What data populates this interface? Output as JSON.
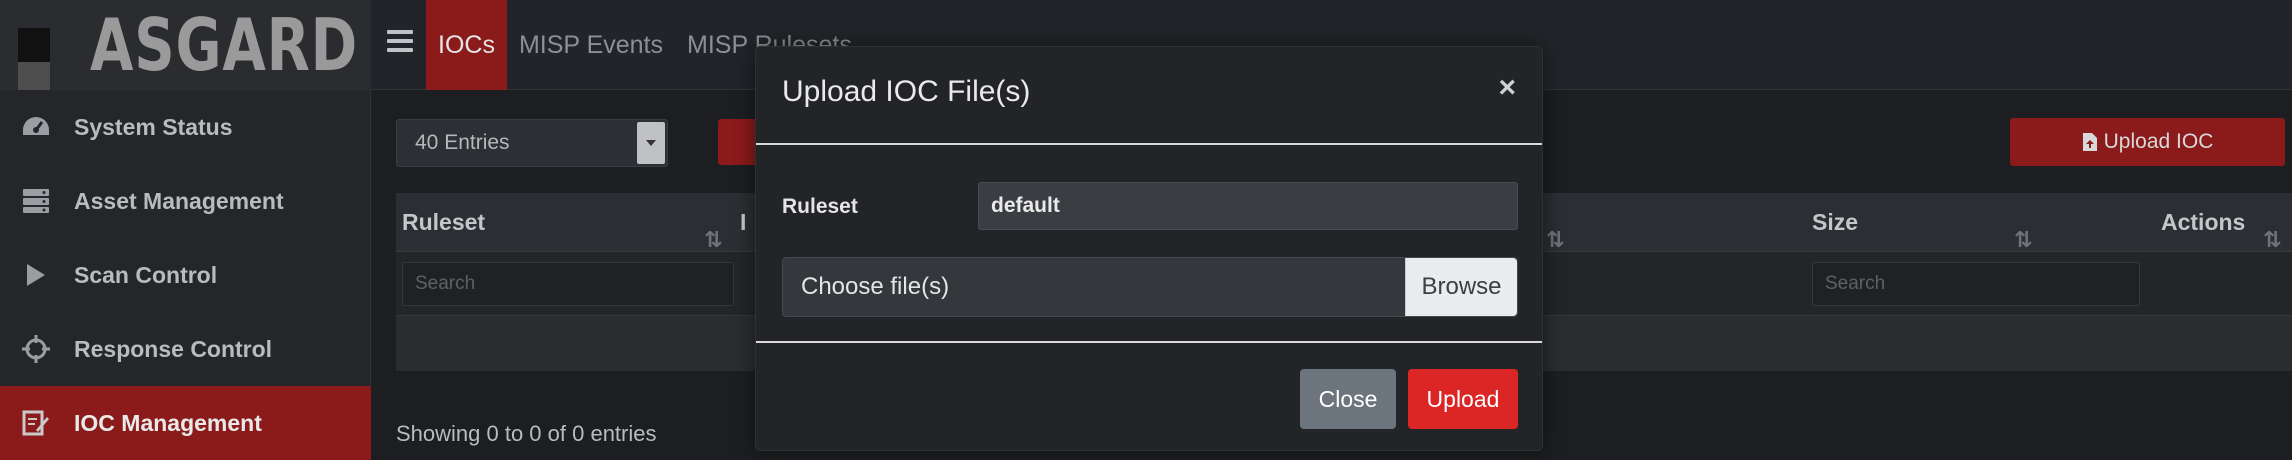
{
  "brand": {
    "name": "ASGARD"
  },
  "topnav": {
    "items": [
      {
        "label": "IOCs",
        "active": true
      },
      {
        "label": "MISP Events",
        "active": false
      },
      {
        "label": "MISP Rulesets",
        "active": false
      }
    ]
  },
  "sidebar": {
    "items": [
      {
        "label": "System Status",
        "icon": "dashboard-gauge-icon"
      },
      {
        "label": "Asset Management",
        "icon": "server-stack-icon"
      },
      {
        "label": "Scan Control",
        "icon": "play-icon"
      },
      {
        "label": "Response Control",
        "icon": "crosshairs-icon"
      },
      {
        "label": "IOC Management",
        "icon": "edit-file-icon",
        "active": true
      }
    ]
  },
  "main": {
    "entries_select": {
      "value": "40 Entries"
    },
    "upload_button": {
      "label": "Upload IOC"
    },
    "table": {
      "columns": [
        {
          "label": "Ruleset",
          "search_placeholder": "Search"
        },
        {
          "label": "I",
          "search_placeholder": ""
        },
        {
          "label": "",
          "search_placeholder": ""
        },
        {
          "label": "Size",
          "search_placeholder": "Search"
        },
        {
          "label": "Actions",
          "search_placeholder": ""
        }
      ],
      "rows": []
    },
    "info": "Showing 0 to 0 of 0 entries"
  },
  "modal": {
    "title": "Upload IOC File(s)",
    "close_glyph": "×",
    "ruleset_label": "Ruleset",
    "ruleset_value": "default",
    "file_placeholder": "Choose file(s)",
    "browse_label": "Browse",
    "close_button": "Close",
    "upload_button": "Upload"
  },
  "colors": {
    "accent_dark_red": "#8b1a1a",
    "primary_red": "#dc2626",
    "secondary_gray": "#6c757d"
  }
}
